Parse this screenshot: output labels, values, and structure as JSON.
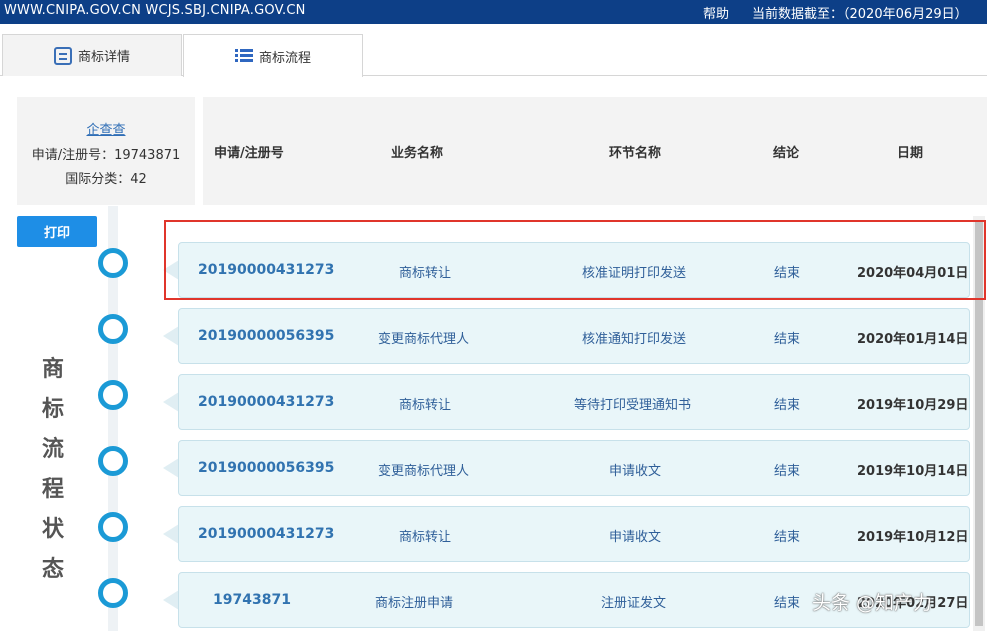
{
  "topbar": {
    "sites": "WWW.CNIPA.GOV.CN  WCJS.SBJ.CNIPA.GOV.CN",
    "help": "帮助",
    "as_of": "当前数据截至：（2020年06月29日）"
  },
  "tabs": [
    {
      "label": "商标详情",
      "icon": "document-icon"
    },
    {
      "label": "商标流程",
      "icon": "list-icon"
    }
  ],
  "info": {
    "link": "企查查",
    "reg_no": "申请/注册号：19743871",
    "class": "国际分类：42"
  },
  "table": {
    "headers": [
      "申请/注册号",
      "业务名称",
      "环节名称",
      "结论",
      "日期"
    ],
    "rows": [
      {
        "no": "20190000431273",
        "business": "商标转让",
        "stage": "核准证明打印发送",
        "result": "结束",
        "date": "2020年04月01日"
      },
      {
        "no": "20190000056395",
        "business": "变更商标代理人",
        "stage": "核准通知打印发送",
        "result": "结束",
        "date": "2020年01月14日"
      },
      {
        "no": "20190000431273",
        "business": "商标转让",
        "stage": "等待打印受理通知书",
        "result": "结束",
        "date": "2019年10月29日"
      },
      {
        "no": "20190000056395",
        "business": "变更商标代理人",
        "stage": "申请收文",
        "result": "结束",
        "date": "2019年10月14日"
      },
      {
        "no": "20190000431273",
        "business": "商标转让",
        "stage": "申请收文",
        "result": "结束",
        "date": "2019年10月12日"
      },
      {
        "no": "19743871",
        "business": "商标注册申请",
        "stage": "注册证发文",
        "result": "结束",
        "date": "2020年02月27日"
      }
    ]
  },
  "print_label": "打印",
  "side_title": [
    "商",
    "标",
    "流",
    "程",
    "状",
    "态"
  ],
  "watermark": "头条 @知产力",
  "colors": {
    "topbar": "#0d3f87",
    "accent": "#1b9ad6",
    "highlight": "#e0352b",
    "card": "#e9f6f9"
  }
}
